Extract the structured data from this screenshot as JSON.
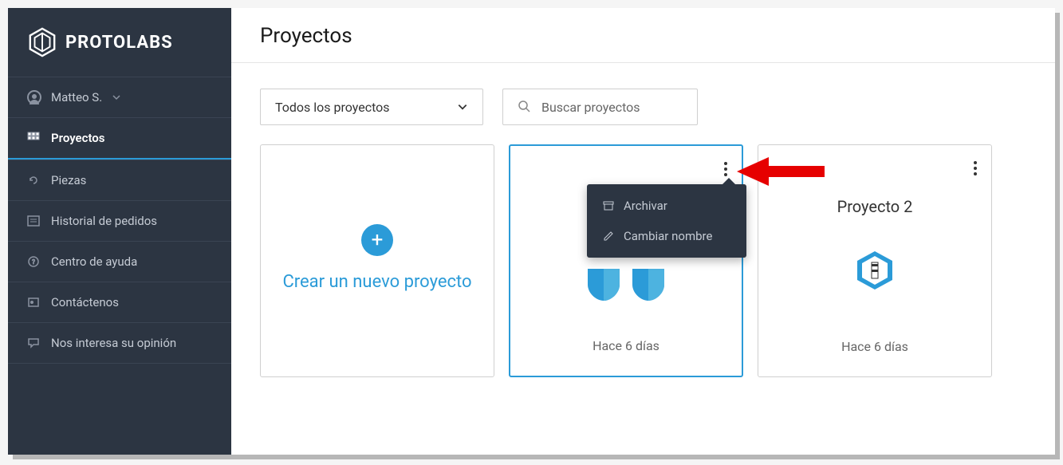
{
  "brand": "PROTOLABS",
  "user": {
    "name": "Matteo S."
  },
  "nav": {
    "projects": "Proyectos",
    "parts": "Piezas",
    "order_history": "Historial de pedidos",
    "help_center": "Centro de ayuda",
    "contact": "Contáctenos",
    "feedback": "Nos interesa su opinión"
  },
  "page": {
    "title": "Proyectos"
  },
  "toolbar": {
    "filter": "Todos los proyectos",
    "search_placeholder": "Buscar proyectos"
  },
  "cards": {
    "new_project": "Crear un nuevo proyecto",
    "project2_title": "Proyecto 2",
    "date": "Hace 6 días"
  },
  "menu": {
    "archive": "Archivar",
    "rename": "Cambiar nombre"
  }
}
